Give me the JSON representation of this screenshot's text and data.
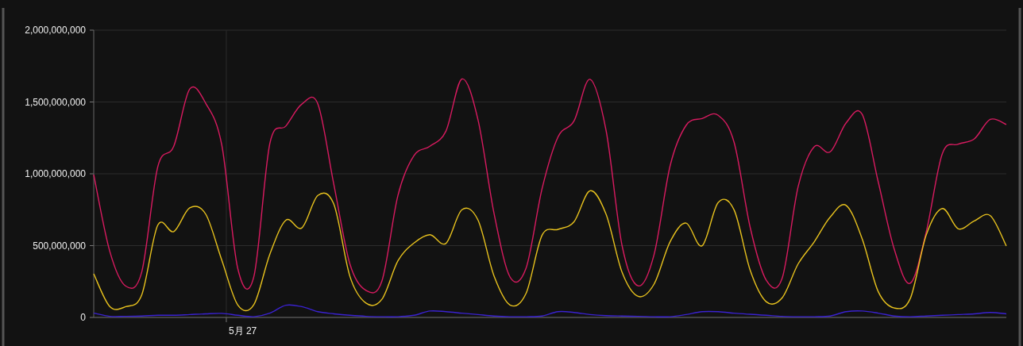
{
  "chart_data": {
    "type": "line",
    "grid": true,
    "series": [
      {
        "color": "#d81b60",
        "values": [
          994000000,
          461000000,
          218000000,
          317000000,
          1048000000,
          1192000000,
          1590000000,
          1490000000,
          1199000000,
          340000000,
          284000000,
          1210000000,
          1332000000,
          1485000000,
          1486000000,
          924000000,
          373000000,
          189000000,
          253000000,
          849000000,
          1126000000,
          1192000000,
          1298000000,
          1660000000,
          1376000000,
          727000000,
          282000000,
          342000000,
          894000000,
          1257000000,
          1368000000,
          1658000000,
          1301000000,
          500000000,
          220000000,
          437000000,
          1055000000,
          1337000000,
          1385000000,
          1408000000,
          1218000000,
          627000000,
          261000000,
          273000000,
          911000000,
          1188000000,
          1153000000,
          1355000000,
          1413000000,
          945000000,
          475000000,
          238000000,
          596000000,
          1140000000,
          1206000000,
          1243000000,
          1379000000,
          1343000000
        ]
      },
      {
        "color": "#e8c21e",
        "values": [
          304000000,
          76000000,
          75000000,
          158000000,
          642000000,
          598000000,
          763000000,
          718000000,
          398000000,
          87000000,
          89000000,
          440000000,
          677000000,
          624000000,
          849000000,
          787000000,
          287000000,
          100000000,
          126000000,
          394000000,
          518000000,
          576000000,
          516000000,
          750000000,
          678000000,
          290000000,
          87000000,
          167000000,
          571000000,
          613000000,
          666000000,
          882000000,
          718000000,
          315000000,
          147000000,
          232000000,
          527000000,
          657000000,
          499000000,
          800000000,
          748000000,
          329000000,
          110000000,
          137000000,
          373000000,
          526000000,
          699000000,
          780000000,
          546000000,
          180000000,
          66000000,
          132000000,
          574000000,
          758000000,
          617000000,
          672000000,
          709000000,
          497000000
        ]
      },
      {
        "color": "#3a22d0",
        "values": [
          30000000,
          8000000,
          8000000,
          10000000,
          15000000,
          15000000,
          20000000,
          25000000,
          28000000,
          15000000,
          5000000,
          30000000,
          85000000,
          75000000,
          40000000,
          25000000,
          15000000,
          8000000,
          5000000,
          5000000,
          15000000,
          45000000,
          40000000,
          30000000,
          20000000,
          10000000,
          5000000,
          5000000,
          10000000,
          40000000,
          35000000,
          20000000,
          12000000,
          10000000,
          8000000,
          5000000,
          5000000,
          20000000,
          40000000,
          40000000,
          30000000,
          22000000,
          15000000,
          8000000,
          5000000,
          5000000,
          10000000,
          40000000,
          45000000,
          30000000,
          10000000,
          5000000,
          10000000,
          15000000,
          20000000,
          25000000,
          35000000,
          25000000
        ]
      }
    ],
    "ylim": [
      0,
      2000000000
    ],
    "annotations": [
      "5月 27"
    ],
    "yticks": [
      {
        "value": 0,
        "label": "0"
      },
      {
        "value": 500000000,
        "label": "500,000,000"
      },
      {
        "value": 1000000000,
        "label": "1,000,000,000"
      },
      {
        "value": 1500000000,
        "label": "1,500,000,000"
      },
      {
        "value": 2000000000,
        "label": "2,000,000,000"
      }
    ]
  }
}
